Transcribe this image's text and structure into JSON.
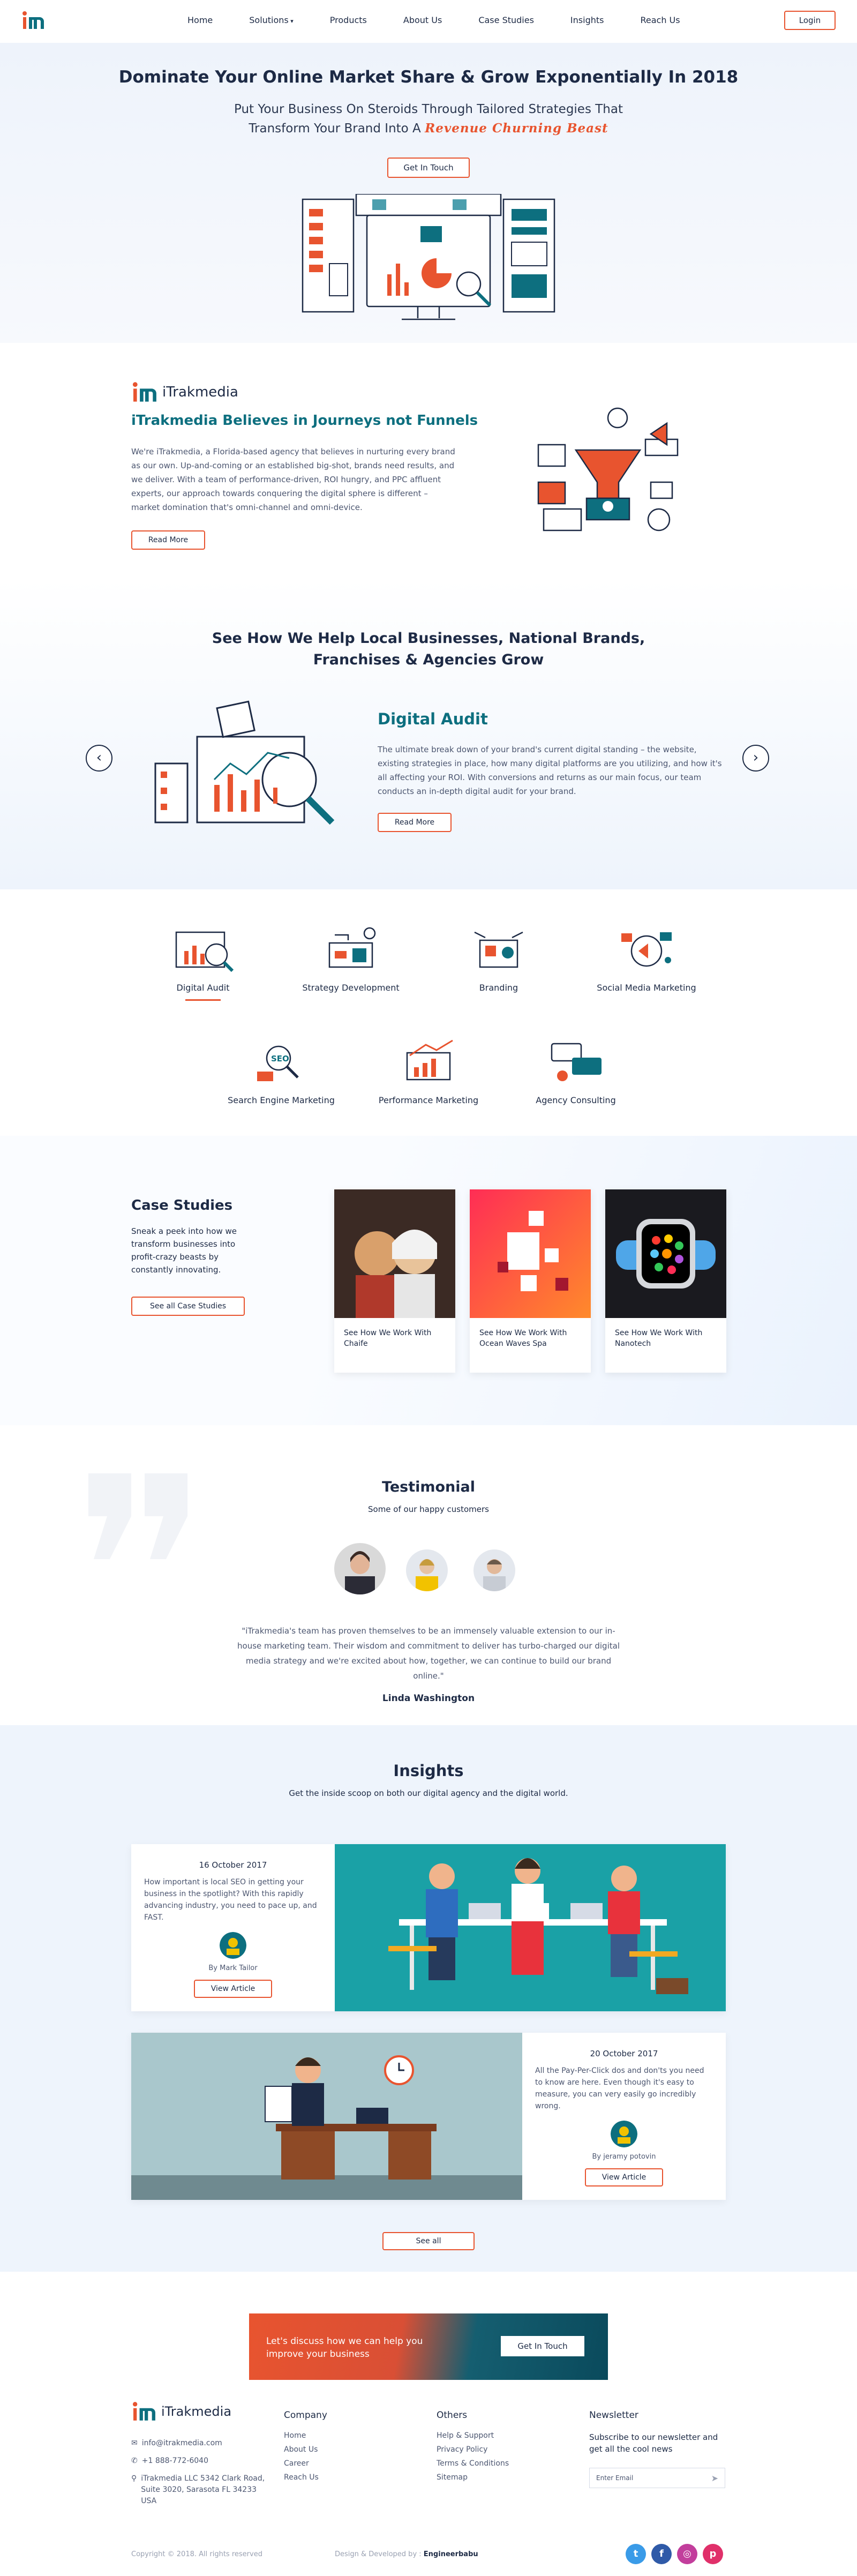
{
  "nav": {
    "logo_alt": "iTrakmedia",
    "items": [
      "Home",
      "Solutions",
      "Products",
      "About Us",
      "Case Studies",
      "Insights",
      "Reach Us"
    ],
    "login": "Login"
  },
  "hero": {
    "title": "Dominate Your Online Market Share & Grow Exponentially In 2018",
    "subtitle_line1": "Put Your Business On Steroids Through Tailored Strategies That",
    "subtitle_line2": "Transform Your Brand Into A",
    "subtitle_highlight": "Revenue Churning Beast",
    "cta": "Get In Touch"
  },
  "about": {
    "brand": "iTrakmedia",
    "heading": "iTrakmedia Believes in Journeys not Funnels",
    "body": "We're iTrakmedia, a Florida-based agency that believes in nurturing every brand as our own. Up-and-coming or an established big-shot, brands need results, and we deliver. With a team of performance-driven, ROI hungry, and PPC affluent experts, our approach towards conquering the digital sphere is different – market domination that's omni-channel and omni-device.",
    "read_more": "Read More"
  },
  "services": {
    "heading_line1": "See How We Help Local Businesses, National Brands,",
    "heading_line2": "Franchises & Agencies Grow",
    "active_title": "Digital Audit",
    "active_body": "The ultimate break down of your brand's current digital standing – the website, existing strategies in place, how many digital platforms are you utilizing, and how it's all affecting your ROI. With conversions and returns as our main focus, our team conducts an in-depth digital audit for your brand.",
    "read_more": "Read More",
    "prev": "‹",
    "next": "›",
    "items": [
      {
        "label": "Digital Audit"
      },
      {
        "label": "Strategy Development"
      },
      {
        "label": "Branding"
      },
      {
        "label": "Social Media Marketing"
      },
      {
        "label": "Search Engine Marketing"
      },
      {
        "label": "Performance Marketing"
      },
      {
        "label": "Agency Consulting"
      }
    ]
  },
  "cases": {
    "heading": "Case Studies",
    "body": "Sneak a peek into how we transform businesses into profit-crazy beasts by constantly innovating.",
    "button": "See all Case Studies",
    "cards": [
      {
        "caption": "See How We Work With Chaife"
      },
      {
        "caption": "See How We Work With Ocean Waves Spa"
      },
      {
        "caption": "See How We Work With Nanotech"
      }
    ]
  },
  "testimonial": {
    "heading": "Testimonial",
    "sub": "Some of our happy customers",
    "quote": "\"iTrakmedia's team has proven themselves to be an immensely valuable extension to our in-house marketing team. Their wisdom and commitment to deliver has turbo-charged our digital media strategy and we're excited about how, together, we can continue to build our brand online.\"",
    "author": "Linda Washington"
  },
  "insights": {
    "heading": "Insights",
    "sub": "Get the inside scoop on both our digital agency and the digital world.",
    "posts": [
      {
        "date": "16 October 2017",
        "excerpt": "How important is local SEO in getting your business in the spotlight? With this rapidly advancing industry, you need to pace up, and FAST.",
        "author": "By Mark Tailor",
        "button": "View Article"
      },
      {
        "date": "20 October 2017",
        "excerpt": "All the Pay-Per-Click dos and don'ts you need to know are here. Even though it's easy to measure, you can very easily go incredibly wrong.",
        "author": "By jeramy potovin",
        "button": "View Article"
      }
    ],
    "see_all": "See all"
  },
  "footer": {
    "banner_text": "Let's discuss how we can help you improve your business",
    "banner_button": "Get In Touch",
    "brand": "iTrakmedia",
    "email": "info@itrakmedia.com",
    "phone": "+1 888-772-6040",
    "address": "iTrakmedia LLC 5342 Clark Road, Suite 3020, Sarasota FL 34233 USA",
    "company_heading": "Company",
    "company_links": [
      "Home",
      "About Us",
      "Career",
      "Reach Us"
    ],
    "others_heading": "Others",
    "others_links": [
      "Help & Support",
      "Privacy Policy",
      "Terms & Conditions",
      "Sitemap"
    ],
    "newsletter_heading": "Newsletter",
    "newsletter_text": "Subscribe to our newsletter and get all the cool news",
    "email_placeholder": "Enter Email",
    "copyright": "Copyright © 2018. All rights reserved",
    "credit_prefix": "Design & Developed by :",
    "credit_name": "Engineerbabu",
    "social": [
      "twitter-icon",
      "facebook-icon",
      "instagram-icon",
      "pinterest-icon"
    ]
  },
  "colors": {
    "accent": "#e8542f",
    "teal": "#0d6f7f",
    "navy": "#1d2a45"
  }
}
